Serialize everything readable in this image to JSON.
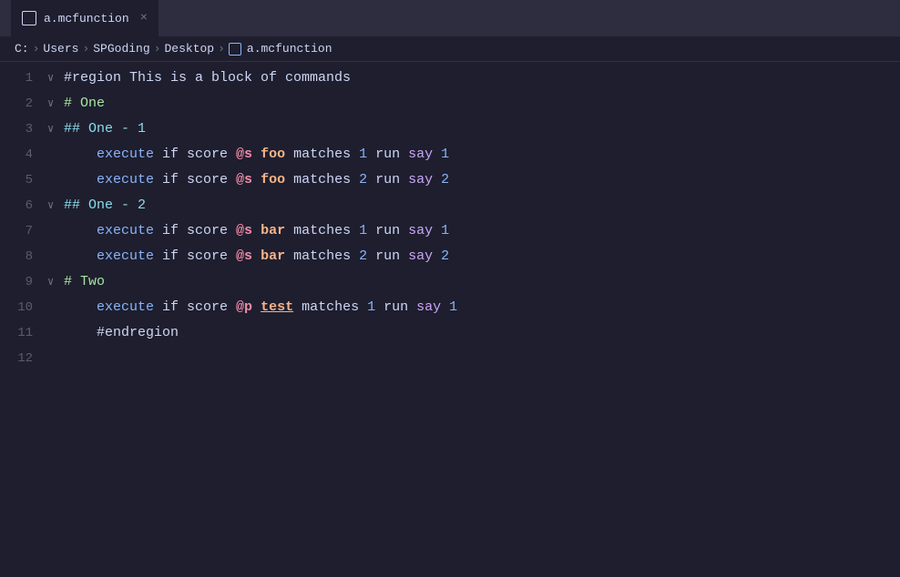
{
  "tab": {
    "filename": "a.mcfunction",
    "close_label": "×",
    "icon_label": "file"
  },
  "breadcrumb": {
    "parts": [
      "C:",
      "Users",
      "SPGoding",
      "Desktop",
      "a.mcfunction"
    ],
    "separators": [
      ">",
      ">",
      ">",
      ">"
    ]
  },
  "lines": [
    {
      "number": "1",
      "fold": "∨",
      "tokens": [
        {
          "text": "#region This is a block of commands",
          "class": "c-region"
        }
      ]
    },
    {
      "number": "2",
      "fold": "∨",
      "tokens": [
        {
          "text": "# One",
          "class": "c-hash-one"
        }
      ]
    },
    {
      "number": "3",
      "fold": "∨",
      "tokens": [
        {
          "text": "## One - 1",
          "class": "c-hash-two"
        }
      ],
      "cursor": true
    },
    {
      "number": "4",
      "fold": "",
      "tokens": [
        {
          "text": "    execute",
          "class": "c-execute"
        },
        {
          "text": " if score ",
          "class": "c-keyword"
        },
        {
          "text": "@s",
          "class": "c-selector"
        },
        {
          "text": " ",
          "class": "c-keyword"
        },
        {
          "text": "foo",
          "class": "c-objective"
        },
        {
          "text": " matches ",
          "class": "c-keyword"
        },
        {
          "text": "1",
          "class": "c-number"
        },
        {
          "text": " run ",
          "class": "c-keyword"
        },
        {
          "text": "say",
          "class": "c-say"
        },
        {
          "text": " ",
          "class": "c-keyword"
        },
        {
          "text": "1",
          "class": "c-number"
        }
      ]
    },
    {
      "number": "5",
      "fold": "",
      "tokens": [
        {
          "text": "    execute",
          "class": "c-execute"
        },
        {
          "text": " if score ",
          "class": "c-keyword"
        },
        {
          "text": "@s",
          "class": "c-selector"
        },
        {
          "text": " ",
          "class": "c-keyword"
        },
        {
          "text": "foo",
          "class": "c-objective"
        },
        {
          "text": " matches ",
          "class": "c-keyword"
        },
        {
          "text": "2",
          "class": "c-number"
        },
        {
          "text": " run ",
          "class": "c-keyword"
        },
        {
          "text": "say",
          "class": "c-say"
        },
        {
          "text": " ",
          "class": "c-keyword"
        },
        {
          "text": "2",
          "class": "c-number"
        }
      ]
    },
    {
      "number": "6",
      "fold": "∨",
      "tokens": [
        {
          "text": "## One - 2",
          "class": "c-hash-two"
        }
      ]
    },
    {
      "number": "7",
      "fold": "",
      "tokens": [
        {
          "text": "    execute",
          "class": "c-execute"
        },
        {
          "text": " if score ",
          "class": "c-keyword"
        },
        {
          "text": "@s",
          "class": "c-selector"
        },
        {
          "text": " ",
          "class": "c-keyword"
        },
        {
          "text": "bar",
          "class": "c-objective"
        },
        {
          "text": " matches ",
          "class": "c-keyword"
        },
        {
          "text": "1",
          "class": "c-number"
        },
        {
          "text": " run ",
          "class": "c-keyword"
        },
        {
          "text": "say",
          "class": "c-say"
        },
        {
          "text": " ",
          "class": "c-keyword"
        },
        {
          "text": "1",
          "class": "c-number"
        }
      ]
    },
    {
      "number": "8",
      "fold": "",
      "tokens": [
        {
          "text": "    execute",
          "class": "c-execute"
        },
        {
          "text": " if score ",
          "class": "c-keyword"
        },
        {
          "text": "@s",
          "class": "c-selector"
        },
        {
          "text": " ",
          "class": "c-keyword"
        },
        {
          "text": "bar",
          "class": "c-objective"
        },
        {
          "text": " matches ",
          "class": "c-keyword"
        },
        {
          "text": "2",
          "class": "c-number"
        },
        {
          "text": " run ",
          "class": "c-keyword"
        },
        {
          "text": "say",
          "class": "c-say"
        },
        {
          "text": " ",
          "class": "c-keyword"
        },
        {
          "text": "2",
          "class": "c-number"
        }
      ]
    },
    {
      "number": "9",
      "fold": "∨",
      "tokens": [
        {
          "text": "# Two",
          "class": "c-hash-one"
        }
      ]
    },
    {
      "number": "10",
      "fold": "",
      "tokens": [
        {
          "text": "    execute",
          "class": "c-execute"
        },
        {
          "text": " if score ",
          "class": "c-keyword"
        },
        {
          "text": "@p",
          "class": "c-selector"
        },
        {
          "text": " ",
          "class": "c-keyword"
        },
        {
          "text": "test",
          "class": "c-test"
        },
        {
          "text": " matches ",
          "class": "c-keyword"
        },
        {
          "text": "1",
          "class": "c-number"
        },
        {
          "text": " run ",
          "class": "c-keyword"
        },
        {
          "text": "say",
          "class": "c-say"
        },
        {
          "text": " ",
          "class": "c-keyword"
        },
        {
          "text": "1",
          "class": "c-number"
        }
      ]
    },
    {
      "number": "11",
      "fold": "",
      "tokens": [
        {
          "text": "    #endregion",
          "class": "c-hash-end"
        }
      ]
    },
    {
      "number": "12",
      "fold": "",
      "tokens": []
    }
  ]
}
